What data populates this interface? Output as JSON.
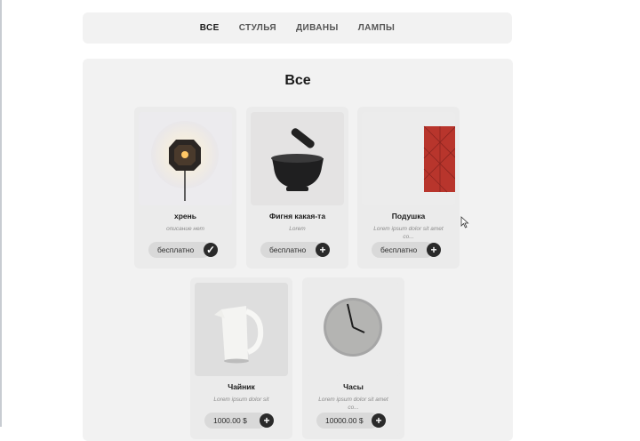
{
  "nav": {
    "tabs": [
      {
        "label": "ВСЕ",
        "active": true
      },
      {
        "label": "СТУЛЬЯ",
        "active": false
      },
      {
        "label": "ДИВАНЫ",
        "active": false
      },
      {
        "label": "ЛАМПЫ",
        "active": false
      }
    ]
  },
  "main": {
    "title": "Все",
    "products": [
      {
        "name": "хрень",
        "description": "описание нет",
        "price": "бесплатно",
        "action_icon": "check-icon"
      },
      {
        "name": "Фигня какая-та",
        "description": "Lorem",
        "price": "бесплатно",
        "action_icon": "plus-icon"
      },
      {
        "name": "Подушка",
        "description": "Lorem ipsum dolor sit amet co...",
        "price": "бесплатно",
        "action_icon": "plus-icon"
      },
      {
        "name": "Чайник",
        "description": "Lorem ipsum dolor sit",
        "price": "1000.00 $",
        "action_icon": "plus-icon"
      },
      {
        "name": "Часы",
        "description": "Lorem ipsum dolor sit amet co...",
        "price": "10000.00 $",
        "action_icon": "plus-icon"
      }
    ]
  },
  "colors": {
    "background": "#ffffff",
    "panel": "#f2f2f2",
    "card": "#ebebeb",
    "price_pill": "#d9d9d9",
    "button": "#2a2a2a",
    "pillow": "#b8352c"
  }
}
